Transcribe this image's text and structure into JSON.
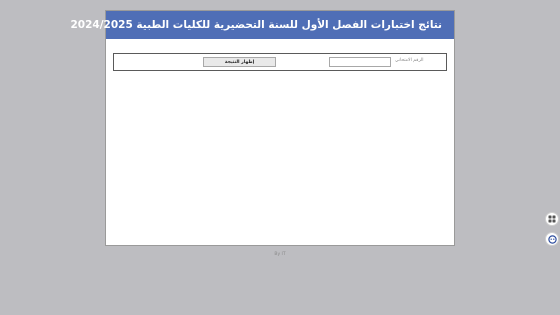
{
  "header": {
    "title": "نتائج اختبارات الفصل الأول للسنة التحضيرية للكليات الطبية 2024/2025"
  },
  "form": {
    "id_label": "الرقم الامتحاني",
    "id_value": "",
    "submit_label": "إظهار النتيجة"
  },
  "footer": {
    "credit": "By IT"
  },
  "colors": {
    "header_bg": "#4f6eb6",
    "page_bg": "#bdbdc1"
  },
  "icons": {
    "side_top": "translate-icon",
    "side_bottom": "support-icon"
  }
}
